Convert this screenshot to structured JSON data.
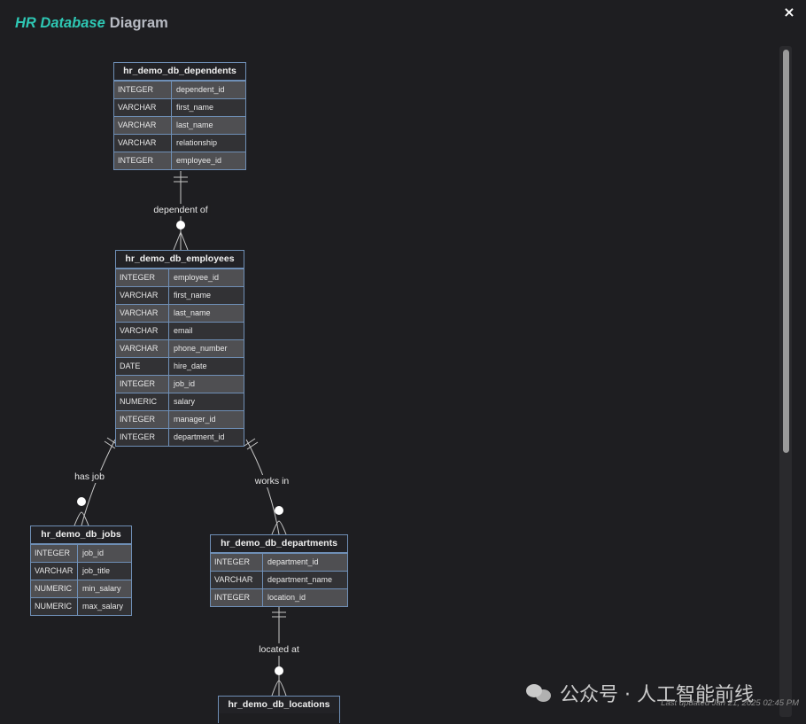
{
  "header": {
    "title_accent": "HR Database",
    "title_rest": "Diagram",
    "close_label": "×"
  },
  "entities": {
    "dependents": {
      "name": "hr_demo_db_dependents",
      "columns": [
        {
          "type": "INTEGER",
          "name": "dependent_id"
        },
        {
          "type": "VARCHAR",
          "name": "first_name"
        },
        {
          "type": "VARCHAR",
          "name": "last_name"
        },
        {
          "type": "VARCHAR",
          "name": "relationship"
        },
        {
          "type": "INTEGER",
          "name": "employee_id"
        }
      ]
    },
    "employees": {
      "name": "hr_demo_db_employees",
      "columns": [
        {
          "type": "INTEGER",
          "name": "employee_id"
        },
        {
          "type": "VARCHAR",
          "name": "first_name"
        },
        {
          "type": "VARCHAR",
          "name": "last_name"
        },
        {
          "type": "VARCHAR",
          "name": "email"
        },
        {
          "type": "VARCHAR",
          "name": "phone_number"
        },
        {
          "type": "DATE",
          "name": "hire_date"
        },
        {
          "type": "INTEGER",
          "name": "job_id"
        },
        {
          "type": "NUMERIC",
          "name": "salary"
        },
        {
          "type": "INTEGER",
          "name": "manager_id"
        },
        {
          "type": "INTEGER",
          "name": "department_id"
        }
      ]
    },
    "jobs": {
      "name": "hr_demo_db_jobs",
      "columns": [
        {
          "type": "INTEGER",
          "name": "job_id"
        },
        {
          "type": "VARCHAR",
          "name": "job_title"
        },
        {
          "type": "NUMERIC",
          "name": "min_salary"
        },
        {
          "type": "NUMERIC",
          "name": "max_salary"
        }
      ]
    },
    "departments": {
      "name": "hr_demo_db_departments",
      "columns": [
        {
          "type": "INTEGER",
          "name": "department_id"
        },
        {
          "type": "VARCHAR",
          "name": "department_name"
        },
        {
          "type": "INTEGER",
          "name": "location_id"
        }
      ]
    },
    "locations": {
      "name": "hr_demo_db_locations",
      "columns": []
    }
  },
  "relationships": [
    {
      "label": "dependent of",
      "from": "employees",
      "to": "dependents"
    },
    {
      "label": "has job",
      "from": "jobs",
      "to": "employees"
    },
    {
      "label": "works in",
      "from": "departments",
      "to": "employees"
    },
    {
      "label": "located at",
      "from": "locations",
      "to": "departments"
    }
  ],
  "footer": {
    "last_updated": "Last updated Jan 21, 2025 02:45 PM",
    "watermark": "公众号 · 人工智能前线"
  },
  "colors": {
    "accent": "#2ec7b4",
    "border": "#6f8fb6",
    "background": "#1e1e21"
  }
}
